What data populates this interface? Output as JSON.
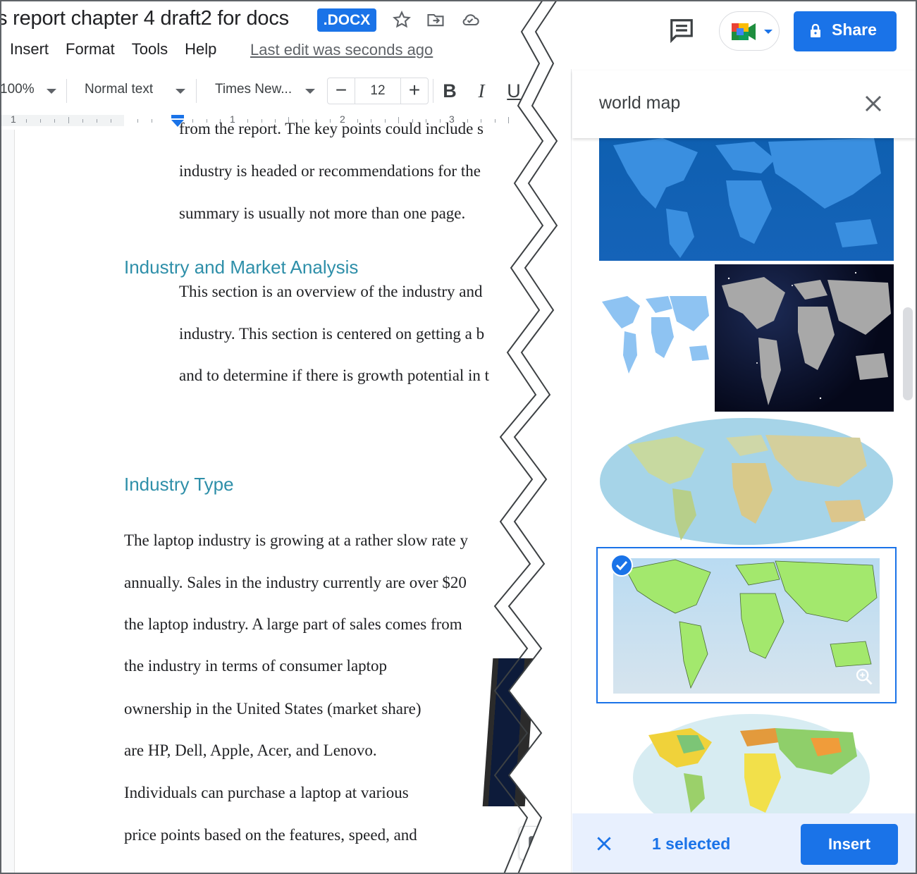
{
  "doc": {
    "title": "s report chapter 4 draft2 for docs",
    "badge": ".DOCX",
    "menu": [
      "Insert",
      "Format",
      "Tools",
      "Help"
    ],
    "last_edit": "Last edit was seconds ago"
  },
  "toolbar": {
    "zoom": "100%",
    "style": "Normal text",
    "font": "Times New...",
    "font_size": "12",
    "minus": "−",
    "plus": "+",
    "bold": "B",
    "italic": "I",
    "underline": "U"
  },
  "ruler": {
    "labels": [
      "1",
      "1",
      "2",
      "3"
    ]
  },
  "content": {
    "cut_line": "from the report.  The key points could include s",
    "para1": [
      "industry is headed or recommendations for the",
      "summary is usually not more than one page."
    ],
    "heading1": "Industry and Market Analysis",
    "para2": [
      "This section is an overview of the industry and",
      "industry.  This section is centered on getting a b",
      "and to determine if there is growth potential in t"
    ],
    "heading2": "Industry Type",
    "para3": [
      "The laptop industry is growing at a rather slow rate y",
      "annually.  Sales in the industry currently are over $20",
      "the laptop industry.  A large part of sales comes from",
      "the industry in terms of consumer laptop",
      "ownership in the United States (market share)",
      "are HP, Dell, Apple, Acer, and Lenovo.",
      "Individuals can purchase a laptop at various",
      "price points based on the features, speed, and"
    ]
  },
  "header_right": {
    "share_label": "Share"
  },
  "search_panel": {
    "query": "world map",
    "selected_count": "1 selected",
    "insert_label": "Insert"
  },
  "colors": {
    "accent": "#1a73e8",
    "heading": "#2e8fa9",
    "selection_bg": "#e8f0fe"
  }
}
